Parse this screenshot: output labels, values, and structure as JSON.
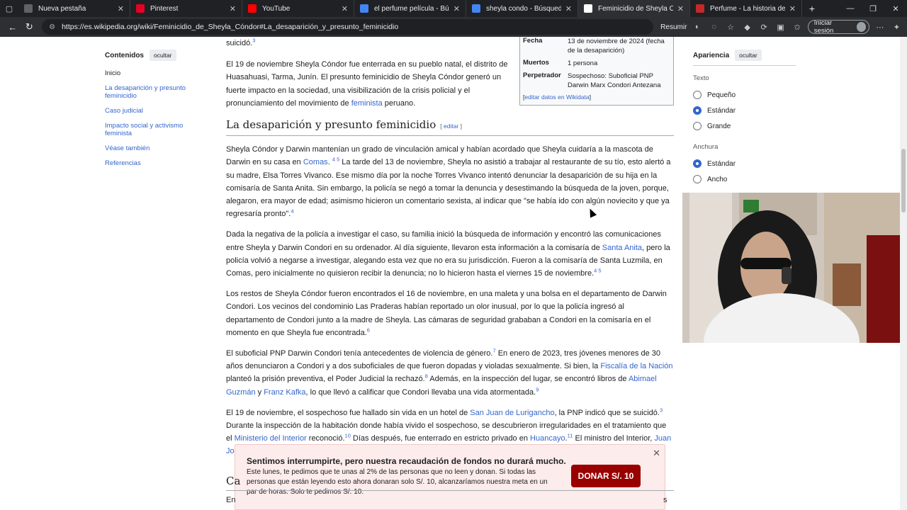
{
  "browser": {
    "tabs": [
      {
        "title": "Nueva pestaña",
        "icon": "new-tab-icon",
        "color": "#5f6368"
      },
      {
        "title": "Pinterest",
        "icon": "pinterest-icon",
        "color": "#e60023"
      },
      {
        "title": "YouTube",
        "icon": "youtube-icon",
        "color": "#ff0000"
      },
      {
        "title": "el perfume película - Búsqueda",
        "icon": "search-icon",
        "color": "#4285f4"
      },
      {
        "title": "sheyla condo - Búsqueda",
        "icon": "search-icon",
        "color": "#4285f4"
      },
      {
        "title": "Feminicidio de Sheyla Cóndor - Wikipedia",
        "icon": "wikipedia-icon",
        "color": "#ffffff",
        "active": true
      },
      {
        "title": "Perfume - La historia de un asesino",
        "icon": "bookmark-icon",
        "color": "#c62828"
      }
    ],
    "url": "https://es.wikipedia.org/wiki/Feminicidio_de_Sheyla_Cóndor#La_desaparición_y_presunto_feminicidio",
    "resume_label": "Resumir",
    "signin_label": "Iniciar sesión"
  },
  "toc": {
    "title": "Contenidos",
    "hide_label": "ocultar",
    "items": [
      "Inicio",
      "La desaparición y presunto feminicidio",
      "Caso judicial",
      "Impacto social y activismo feminista",
      "Véase también",
      "Referencias"
    ]
  },
  "infobox": {
    "rows": [
      {
        "label": "Fecha",
        "value": "13 de noviembre de 2024 (fecha de la desaparición)"
      },
      {
        "label": "Muertos",
        "value": "1 persona"
      },
      {
        "label": "Perpetrador",
        "value": "Sospechoso: Suboficial PNP Darwin Marx Condori Antezana"
      }
    ],
    "wikidata_label": "editar datos en Wikidata"
  },
  "appearance": {
    "title": "Apariencia",
    "hide_label": "ocultar",
    "text_label": "Texto",
    "text_options": [
      "Pequeño",
      "Estándar",
      "Grande"
    ],
    "width_label": "Anchura",
    "width_options": [
      "Estándar",
      "Ancho"
    ]
  },
  "article": {
    "p0": {
      "a": "suicidó.",
      "ref": "3"
    },
    "p1": {
      "a": "El 19 de noviembre Sheyla Cóndor fue enterrada en su pueblo natal, el distrito de Huasahuasi, Tarma, Junín. El presunto feminicidio de Sheyla Cóndor generó un fuerte impacto en la sociedad, una visibilización de la crisis policial y el pronunciamiento del movimiento de ",
      "link": "feminista",
      "b": " peruano."
    },
    "section_title": "La desaparición y presunto feminicidio",
    "edit_label": "editar",
    "p2": {
      "a": "Sheyla Cóndor y Darwin mantenían un grado de vinculación amical y habían acordado que Sheyla cuidaría a la mascota de Darwin en su casa en ",
      "link": "Comas",
      "ref1": "4 5",
      "b": " La tarde del 13 de noviembre, Sheyla no asistió a trabajar al restaurante de su tío, esto alertó a su madre, Elsa Torres Vivanco. Ese mismo día por la noche Torres Vivanco intentó denunciar la desaparición de su hija en la comisaría de Santa Anita. Sin embargo, la policía se negó a tomar la denuncia y desestimando la búsqueda de la joven, porque, alegaron, era mayor de edad; asimismo hicieron un comentario sexista, al indicar que \"se había ido con algún noviecito y que ya regresaría pronto\".",
      "ref2": "4"
    },
    "p3": {
      "a": "Dada la negativa de la policía a investigar el caso, su familia inició la búsqueda de información y encontró las comunicaciones entre Sheyla y Darwin Condori en su ordenador. Al día siguiente, llevaron esta información a la comisaría de ",
      "link": "Santa Anita",
      "b": ", pero la policía volvió a negarse a investigar, alegando esta vez que no era su jurisdicción. Fueron a la comisaría de Santa Luzmila, en Comas, pero inicialmente no quisieron recibir la denuncia; no lo hicieron hasta el viernes 15 de noviembre.",
      "ref": "4 5"
    },
    "p4": {
      "a": "Los restos de Sheyla Cóndor fueron encontrados el 16 de noviembre, en una maleta y una bolsa en el departamento de Darwin Condori. Los vecinos del condominio Las Praderas habían reportado un olor inusual, por lo que la policía ingresó al departamento de Condori junto a la madre de Sheyla. Las cámaras de seguridad grababan a Condori en la comisaría en el momento en que Sheyla fue encontrada.",
      "ref": "6"
    },
    "p5": {
      "a": "El suboficial PNP Darwin Condori tenía antecedentes de violencia de género.",
      "ref1": "7",
      "b": " En enero de 2023, tres jóvenes menores de 30 años denunciaron a Condori y a dos suboficiales de que fueron dopadas y violadas sexualmente. Si bien, la ",
      "link1": "Fiscalía de la Nación",
      "c": " planteó la prisión preventiva, el Poder Judicial la rechazó.",
      "ref2": "8",
      "d": " Además, en la inspección del lugar, se encontró libros de ",
      "link2": "Abimael Guzmán",
      "e": " y ",
      "link3": "Franz Kafka",
      "f": ", lo que llevó a calificar que Condori llevaba una vida atormentada.",
      "ref3": "9"
    },
    "p6": {
      "a": "El 19 de noviembre, el sospechoso fue hallado sin vida en un hotel de ",
      "link1": "San Juan de Lurigancho",
      "b": ", la PNP indicó que se suicidó.",
      "ref1": "3",
      "c": " Durante la inspección de la habitación donde había vivido el sospechoso, se descubrieron irregularidades en el tratamiento que el ",
      "link2": "Ministerio del Interior",
      "d": " reconoció.",
      "ref2": "10",
      "e": " Días después, fue enterrado en estricto privado en ",
      "link3": "Huancayo",
      "ref3": "11",
      "f": " El ministro del Interior, ",
      "link4": "Juan Jo"
    },
    "cut_heading": "Ca",
    "cut_text_left": "En",
    "cut_text_right": "s"
  },
  "banner": {
    "title": "Sentimos interrumpirte, pero nuestra recaudación de fondos no durará mucho.",
    "body": "Este lunes, te pedimos que te unas al 2% de las personas que no leen y donan. Si todas las personas que están leyendo esto ahora donaran solo S/. 10, alcanzaríamos nuestra meta en un par de horas. Solo te pedimos S/. 10.",
    "donate_label": "DONAR S/. 10"
  }
}
